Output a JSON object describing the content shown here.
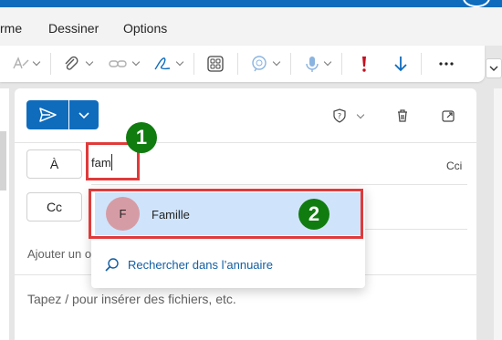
{
  "menu": {
    "item1": "rme",
    "item2": "Dessiner",
    "item3": "Options"
  },
  "recipients": {
    "to_label": "À",
    "to_value": "fam",
    "cc_label": "Cc",
    "bcc_label": "Cci",
    "subject_placeholder": "Ajouter un o"
  },
  "body": {
    "placeholder": "Tapez / pour insérer des fichiers, etc."
  },
  "suggestion": {
    "initial": "F",
    "name": "Famille",
    "search_label": "Rechercher dans l’annuaire"
  },
  "annotations": {
    "step1": "1",
    "step2": "2"
  },
  "colors": {
    "accent": "#0f6cbd",
    "highlight": "#cfe4fa",
    "avatar": "#d69ca5",
    "annotation_box": "#e03a3a",
    "annotation_badge": "#107c10",
    "importance": "#c50f1f"
  }
}
